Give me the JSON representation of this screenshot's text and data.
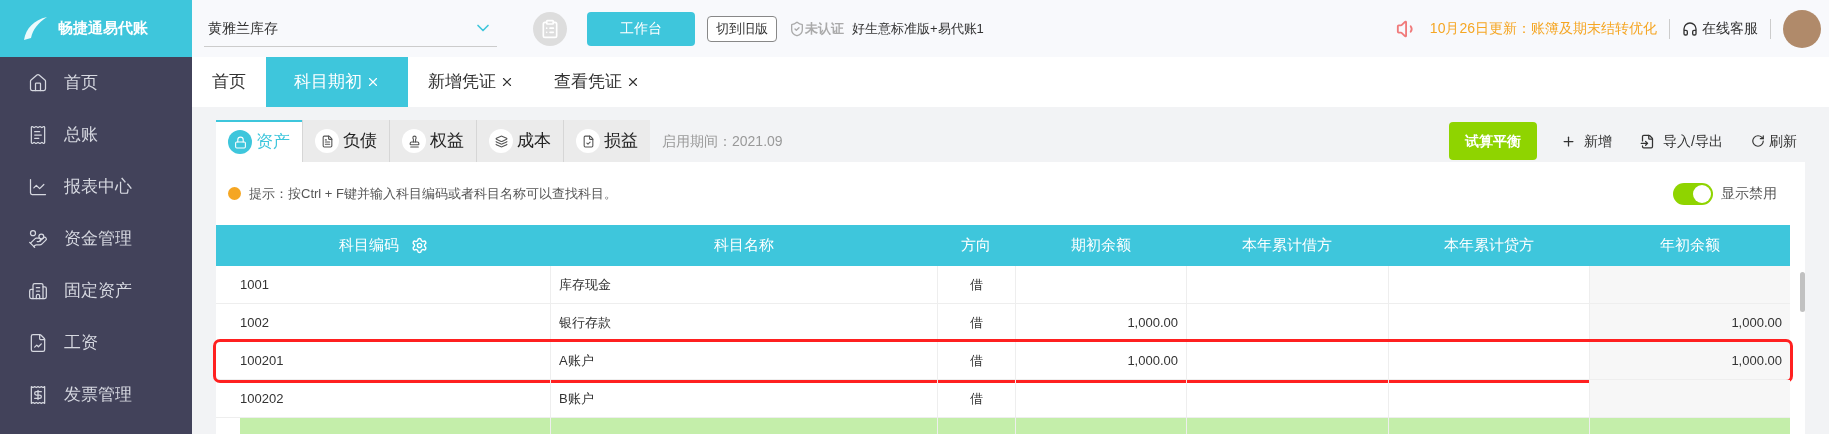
{
  "brand": {
    "name": "畅捷通易代账"
  },
  "topbar": {
    "company": "黄雅兰库存",
    "workbench": "工作台",
    "switch_old": "切到旧版",
    "cert_status": "未认证",
    "edition": "好生意标准版+易代账1",
    "notice": "10月26日更新：账簿及期末结转优化",
    "support": "在线客服"
  },
  "sidebar": {
    "items": [
      {
        "label": "首页"
      },
      {
        "label": "总账"
      },
      {
        "label": "报表中心"
      },
      {
        "label": "资金管理"
      },
      {
        "label": "固定资产"
      },
      {
        "label": "工资"
      },
      {
        "label": "发票管理"
      }
    ]
  },
  "tabs": [
    {
      "label": "首页",
      "selected": false,
      "closable": false
    },
    {
      "label": "科目期初",
      "selected": true,
      "closable": true
    },
    {
      "label": "新增凭证",
      "selected": false,
      "closable": true
    },
    {
      "label": "查看凭证",
      "selected": false,
      "closable": true
    }
  ],
  "categories": [
    {
      "label": "资产",
      "selected": true
    },
    {
      "label": "负债",
      "selected": false
    },
    {
      "label": "权益",
      "selected": false
    },
    {
      "label": "成本",
      "selected": false
    },
    {
      "label": "损益",
      "selected": false
    }
  ],
  "start_period": "启用期间：2021.09",
  "actions": {
    "balance": "试算平衡",
    "add": "新增",
    "import_export": "导入/导出",
    "refresh": "刷新"
  },
  "hint": "提示：按Ctrl + F键并输入科目编码或者科目名称可以查找科目。",
  "show_disabled": {
    "label": "显示禁用",
    "on": true
  },
  "table": {
    "columns": [
      {
        "label": "科目编码"
      },
      {
        "label": "科目名称"
      },
      {
        "label": "方向"
      },
      {
        "label": "期初余额"
      },
      {
        "label": "本年累计借方"
      },
      {
        "label": "本年累计贷方"
      },
      {
        "label": "年初余额"
      }
    ],
    "rows": [
      {
        "cells": [
          "1001",
          "库存现金",
          "借",
          "",
          "",
          "",
          ""
        ],
        "selected": false,
        "marked": false
      },
      {
        "cells": [
          "1002",
          "银行存款",
          "借",
          "1,000.00",
          "",
          "",
          "1,000.00"
        ],
        "selected": false,
        "marked": false
      },
      {
        "cells": [
          "100201",
          "A账户",
          "借",
          "1,000.00",
          "",
          "",
          "1,000.00"
        ],
        "selected": false,
        "marked": true
      },
      {
        "cells": [
          "100202",
          "B账户",
          "借",
          "",
          "",
          "",
          ""
        ],
        "selected": false,
        "marked": false
      },
      {
        "cells": [
          "",
          "",
          "",
          "",
          "",
          "",
          ""
        ],
        "selected": true,
        "marked": false
      }
    ]
  }
}
